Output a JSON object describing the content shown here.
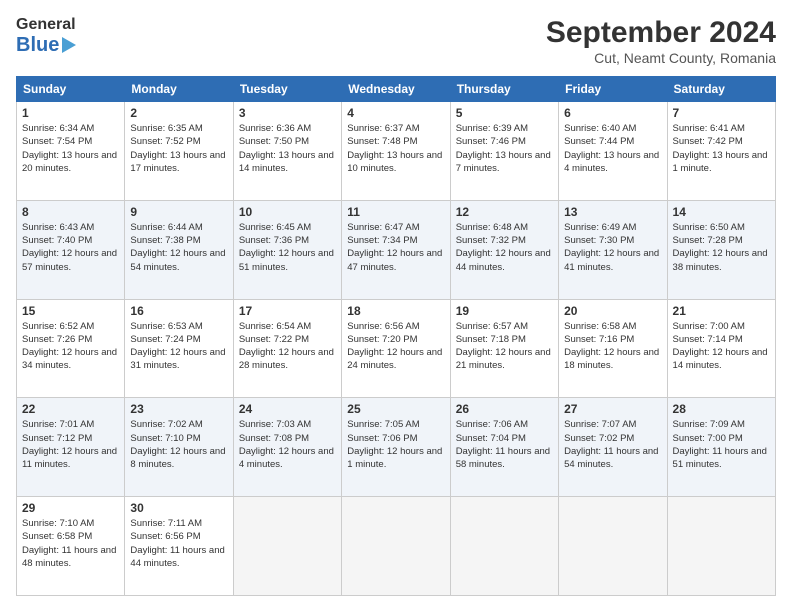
{
  "header": {
    "logo_general": "General",
    "logo_blue": "Blue",
    "title": "September 2024",
    "location": "Cut, Neamt County, Romania"
  },
  "days_of_week": [
    "Sunday",
    "Monday",
    "Tuesday",
    "Wednesday",
    "Thursday",
    "Friday",
    "Saturday"
  ],
  "weeks": [
    [
      {
        "day": "1",
        "sunrise": "6:34 AM",
        "sunset": "7:54 PM",
        "daylight": "13 hours and 20 minutes."
      },
      {
        "day": "2",
        "sunrise": "6:35 AM",
        "sunset": "7:52 PM",
        "daylight": "13 hours and 17 minutes."
      },
      {
        "day": "3",
        "sunrise": "6:36 AM",
        "sunset": "7:50 PM",
        "daylight": "13 hours and 14 minutes."
      },
      {
        "day": "4",
        "sunrise": "6:37 AM",
        "sunset": "7:48 PM",
        "daylight": "13 hours and 10 minutes."
      },
      {
        "day": "5",
        "sunrise": "6:39 AM",
        "sunset": "7:46 PM",
        "daylight": "13 hours and 7 minutes."
      },
      {
        "day": "6",
        "sunrise": "6:40 AM",
        "sunset": "7:44 PM",
        "daylight": "13 hours and 4 minutes."
      },
      {
        "day": "7",
        "sunrise": "6:41 AM",
        "sunset": "7:42 PM",
        "daylight": "13 hours and 1 minute."
      }
    ],
    [
      {
        "day": "8",
        "sunrise": "6:43 AM",
        "sunset": "7:40 PM",
        "daylight": "12 hours and 57 minutes."
      },
      {
        "day": "9",
        "sunrise": "6:44 AM",
        "sunset": "7:38 PM",
        "daylight": "12 hours and 54 minutes."
      },
      {
        "day": "10",
        "sunrise": "6:45 AM",
        "sunset": "7:36 PM",
        "daylight": "12 hours and 51 minutes."
      },
      {
        "day": "11",
        "sunrise": "6:47 AM",
        "sunset": "7:34 PM",
        "daylight": "12 hours and 47 minutes."
      },
      {
        "day": "12",
        "sunrise": "6:48 AM",
        "sunset": "7:32 PM",
        "daylight": "12 hours and 44 minutes."
      },
      {
        "day": "13",
        "sunrise": "6:49 AM",
        "sunset": "7:30 PM",
        "daylight": "12 hours and 41 minutes."
      },
      {
        "day": "14",
        "sunrise": "6:50 AM",
        "sunset": "7:28 PM",
        "daylight": "12 hours and 38 minutes."
      }
    ],
    [
      {
        "day": "15",
        "sunrise": "6:52 AM",
        "sunset": "7:26 PM",
        "daylight": "12 hours and 34 minutes."
      },
      {
        "day": "16",
        "sunrise": "6:53 AM",
        "sunset": "7:24 PM",
        "daylight": "12 hours and 31 minutes."
      },
      {
        "day": "17",
        "sunrise": "6:54 AM",
        "sunset": "7:22 PM",
        "daylight": "12 hours and 28 minutes."
      },
      {
        "day": "18",
        "sunrise": "6:56 AM",
        "sunset": "7:20 PM",
        "daylight": "12 hours and 24 minutes."
      },
      {
        "day": "19",
        "sunrise": "6:57 AM",
        "sunset": "7:18 PM",
        "daylight": "12 hours and 21 minutes."
      },
      {
        "day": "20",
        "sunrise": "6:58 AM",
        "sunset": "7:16 PM",
        "daylight": "12 hours and 18 minutes."
      },
      {
        "day": "21",
        "sunrise": "7:00 AM",
        "sunset": "7:14 PM",
        "daylight": "12 hours and 14 minutes."
      }
    ],
    [
      {
        "day": "22",
        "sunrise": "7:01 AM",
        "sunset": "7:12 PM",
        "daylight": "12 hours and 11 minutes."
      },
      {
        "day": "23",
        "sunrise": "7:02 AM",
        "sunset": "7:10 PM",
        "daylight": "12 hours and 8 minutes."
      },
      {
        "day": "24",
        "sunrise": "7:03 AM",
        "sunset": "7:08 PM",
        "daylight": "12 hours and 4 minutes."
      },
      {
        "day": "25",
        "sunrise": "7:05 AM",
        "sunset": "7:06 PM",
        "daylight": "12 hours and 1 minute."
      },
      {
        "day": "26",
        "sunrise": "7:06 AM",
        "sunset": "7:04 PM",
        "daylight": "11 hours and 58 minutes."
      },
      {
        "day": "27",
        "sunrise": "7:07 AM",
        "sunset": "7:02 PM",
        "daylight": "11 hours and 54 minutes."
      },
      {
        "day": "28",
        "sunrise": "7:09 AM",
        "sunset": "7:00 PM",
        "daylight": "11 hours and 51 minutes."
      }
    ],
    [
      {
        "day": "29",
        "sunrise": "7:10 AM",
        "sunset": "6:58 PM",
        "daylight": "11 hours and 48 minutes."
      },
      {
        "day": "30",
        "sunrise": "7:11 AM",
        "sunset": "6:56 PM",
        "daylight": "11 hours and 44 minutes."
      },
      null,
      null,
      null,
      null,
      null
    ]
  ]
}
